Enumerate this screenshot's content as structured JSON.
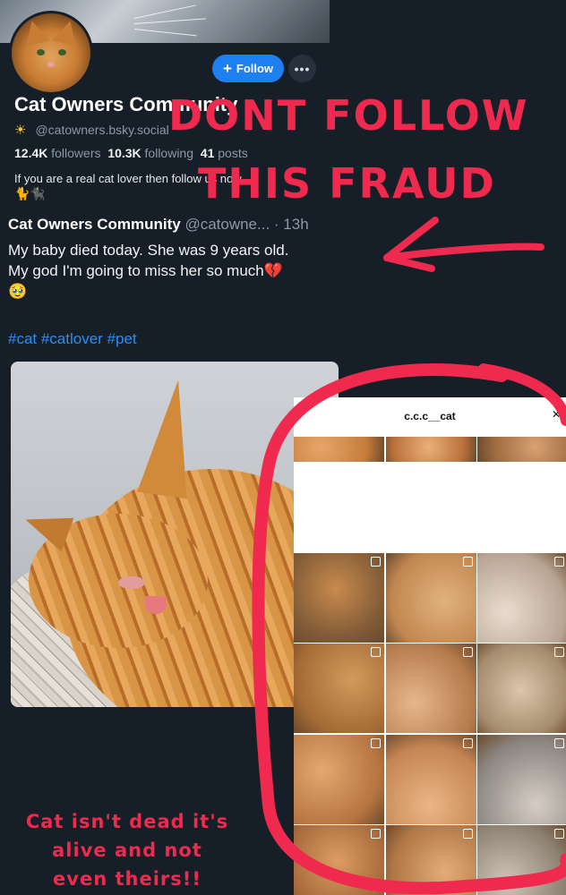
{
  "profile": {
    "name": "Cat Owners Community",
    "handle": "@catowners.bsky.social",
    "follow_label": "Follow",
    "more_label": "•••",
    "followers_count": "12.4K",
    "followers_label": "followers",
    "following_count": "10.3K",
    "following_label": "following",
    "posts_count": "41",
    "posts_label": "posts",
    "bio": "If you are a real cat lover then follow us now",
    "bio_emoji": "🐈🐈‍⬛"
  },
  "post": {
    "author": "Cat Owners Community",
    "handle": "@catowne...",
    "time": "· 13h",
    "text_line1": "My baby died today. She was 9 years old.",
    "text_line2": "My god I'm going to miss her so much💔",
    "text_line3": "🥹",
    "tags": "#cat #catlover #pet"
  },
  "overlay": {
    "warning_line1": "DONT FOLLOW",
    "warning_line2": "THIS FRAUD",
    "caption_line1": "Cat isn't dead it's",
    "caption_line2": "alive and not",
    "caption_line3": "even theirs!!",
    "accent_color": "#f0294e"
  },
  "instagram": {
    "username": "c.c.c__cat",
    "tabs": [
      "grid-icon",
      "reels-icon",
      "tagged-icon"
    ]
  }
}
